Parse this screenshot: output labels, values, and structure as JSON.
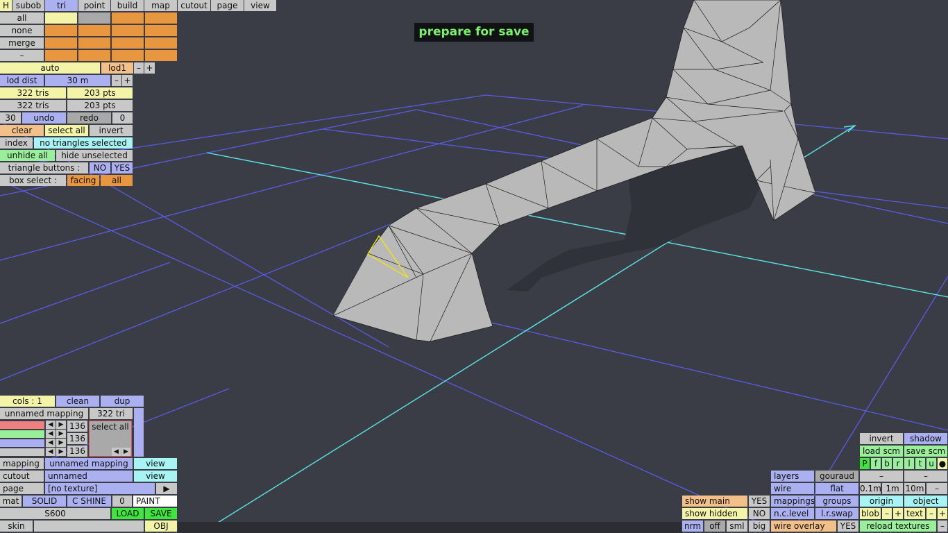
{
  "banner": "prepare for save",
  "topmenu": {
    "h": "H",
    "tabs": [
      "subob",
      "tri",
      "point",
      "build",
      "map",
      "cutout",
      "page",
      "view"
    ]
  },
  "sel_rows": [
    "all",
    "none",
    "merge",
    "–"
  ],
  "panel": {
    "auto": "auto",
    "lod": "lod1",
    "minus": "–",
    "plus": "+",
    "lod_dist_label": "lod dist",
    "lod_dist_value": "30 m",
    "tris1": "322 tris",
    "pts1": "203 pts",
    "tris2": "322 tris",
    "pts2": "203 pts",
    "undo_count": "30",
    "undo": "undo",
    "redo": "redo",
    "redo_count": "0",
    "clear": "clear",
    "select_all": "select all",
    "invert": "invert",
    "index": "index",
    "selection_status": "no triangles selected",
    "unhide_all": "unhide all",
    "hide_unselected": "hide unselected",
    "triangle_buttons": "triangle buttons :",
    "no": "NO",
    "yes": "YES",
    "box_select": "box select :",
    "facing": "facing",
    "all": "all"
  },
  "mapping_panel": {
    "cols": "cols : 1",
    "clean": "clean",
    "dup": "dup",
    "mapping_name": "unnamed mapping",
    "tri_count": "322 tri",
    "r_value": "136",
    "g_value": "136",
    "b_value": "136",
    "select_all": "select all",
    "mapping_label": "mapping",
    "mapping_value": "unnamed mapping",
    "view1": "view",
    "cutout_label": "cutout",
    "cutout_value": "unnamed",
    "view2": "view",
    "page_label": "page",
    "page_value": "[no texture]",
    "page_arrow": "▶",
    "mat": "mat",
    "solid": "SOLID",
    "c_shine": "C SHINE",
    "zero": "0",
    "paint": "PAINT",
    "material_name": "S600",
    "load": "LOAD",
    "save": "SAVE",
    "skin": "skin",
    "obj": "OBJ"
  },
  "right_panel": {
    "invert": "invert",
    "shadow": "shadow",
    "load_scm": "load scm",
    "save_scm": "save scm",
    "flags": [
      "P",
      "f",
      "b",
      "r",
      "l",
      "t",
      "u",
      "●"
    ],
    "layers": "layers",
    "gouraud": "gouraud",
    "dash1": "–",
    "dash2": "–",
    "wire": "wire",
    "flat": "flat",
    "d01": "0.1m",
    "d1": "1m",
    "d10": "10m",
    "dminus": "–",
    "show_main": "show main",
    "show_main_val": "YES",
    "mappings": "mappings",
    "groups": "groups",
    "origin": "origin",
    "object": "object",
    "show_hidden": "show hidden",
    "show_hidden_val": "NO",
    "nc_level": "n.c.level",
    "lr_swap": "l.r.swap",
    "blob": "blob",
    "text": "text",
    "m": "–",
    "p": "+",
    "nrm": "nrm",
    "off": "off",
    "sml": "sml",
    "big": "big",
    "wire_overlay": "wire overlay",
    "wire_overlay_val": "YES",
    "reload_textures": "reload textures"
  },
  "colors": {
    "background": "#3b3d46",
    "grid": "#5a5ae6",
    "axis": "#5ae6e6",
    "mesh": "#b8b8b8",
    "selection": "#f0e020",
    "banner_text": "#7cf06a"
  }
}
